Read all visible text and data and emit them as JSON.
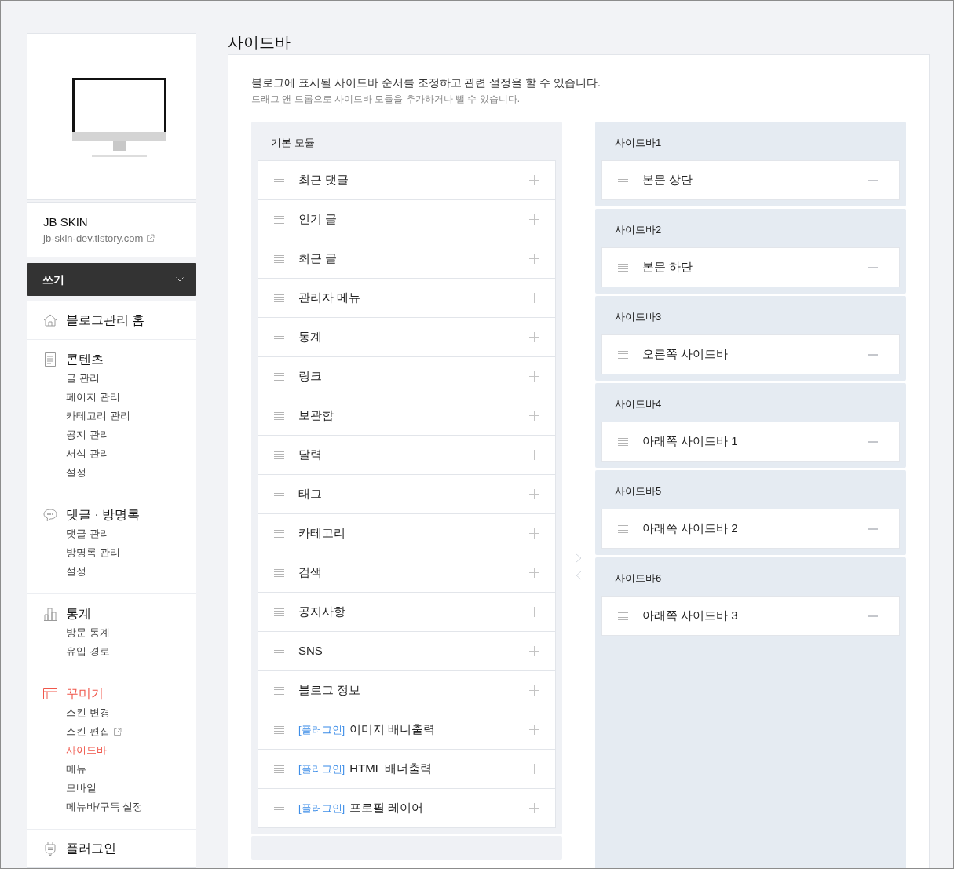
{
  "blog": {
    "name": "JB SKIN",
    "url": "jb-skin-dev.tistory.com"
  },
  "write_button": {
    "label": "쓰기"
  },
  "nav": [
    {
      "kind": "home",
      "title": "블로그관리 홈",
      "selected": false
    },
    {
      "kind": "document",
      "title": "콘텐츠",
      "selected": false,
      "children": [
        {
          "label": "글 관리",
          "selected": false,
          "external": false
        },
        {
          "label": "페이지 관리",
          "selected": false,
          "external": false
        },
        {
          "label": "카테고리 관리",
          "selected": false,
          "external": false
        },
        {
          "label": "공지 관리",
          "selected": false,
          "external": false
        },
        {
          "label": "서식 관리",
          "selected": false,
          "external": false
        },
        {
          "label": "설정",
          "selected": false,
          "external": false
        }
      ]
    },
    {
      "kind": "chat",
      "title": "댓글 · 방명록",
      "selected": false,
      "children": [
        {
          "label": "댓글 관리",
          "selected": false,
          "external": false
        },
        {
          "label": "방명록 관리",
          "selected": false,
          "external": false
        },
        {
          "label": "설정",
          "selected": false,
          "external": false
        }
      ]
    },
    {
      "kind": "chart",
      "title": "통계",
      "selected": false,
      "children": [
        {
          "label": "방문 통계",
          "selected": false,
          "external": false
        },
        {
          "label": "유입 경로",
          "selected": false,
          "external": false
        }
      ]
    },
    {
      "kind": "layout",
      "title": "꾸미기",
      "selected": true,
      "children": [
        {
          "label": "스킨 변경",
          "selected": false,
          "external": false
        },
        {
          "label": "스킨 편집",
          "selected": false,
          "external": true
        },
        {
          "label": "사이드바",
          "selected": true,
          "external": false
        },
        {
          "label": "메뉴",
          "selected": false,
          "external": false
        },
        {
          "label": "모바일",
          "selected": false,
          "external": false
        },
        {
          "label": "메뉴바/구독 설정",
          "selected": false,
          "external": false
        }
      ]
    },
    {
      "kind": "plug",
      "title": "플러그인",
      "selected": false
    }
  ],
  "page_title": "사이드바",
  "description": "블로그에 표시될 사이드바 순서를 조정하고 관련 설정을 할 수 있습니다.",
  "hint": "드래그 앤 드롭으로 사이드바 모듈을 추가하거나 뺄 수 있습니다.",
  "basic_modules": {
    "title": "기본 모듈",
    "items": [
      {
        "label": "최근 댓글"
      },
      {
        "label": "인기 글"
      },
      {
        "label": "최근 글"
      },
      {
        "label": "관리자 메뉴"
      },
      {
        "label": "통계"
      },
      {
        "label": "링크"
      },
      {
        "label": "보관함"
      },
      {
        "label": "달력"
      },
      {
        "label": "태그"
      },
      {
        "label": "카테고리"
      },
      {
        "label": "검색"
      },
      {
        "label": "공지사항"
      },
      {
        "label": "SNS"
      },
      {
        "label": "블로그 정보"
      },
      {
        "tag": "[플러그인]",
        "label": "이미지 배너출력"
      },
      {
        "tag": "[플러그인]",
        "label": "HTML 배너출력"
      },
      {
        "tag": "[플러그인]",
        "label": "프로필 레이어"
      }
    ]
  },
  "sidebars": [
    {
      "title": "사이드바1",
      "items": [
        {
          "label": "본문 상단"
        }
      ]
    },
    {
      "title": "사이드바2",
      "items": [
        {
          "label": "본문 하단"
        }
      ]
    },
    {
      "title": "사이드바3",
      "items": [
        {
          "label": "오른쪽 사이드바"
        }
      ]
    },
    {
      "title": "사이드바4",
      "items": [
        {
          "label": "아래쪽 사이드바 1"
        }
      ]
    },
    {
      "title": "사이드바5",
      "items": [
        {
          "label": "아래쪽 사이드바 2"
        }
      ]
    },
    {
      "title": "사이드바6",
      "items": [
        {
          "label": "아래쪽 사이드바 3"
        }
      ]
    }
  ]
}
